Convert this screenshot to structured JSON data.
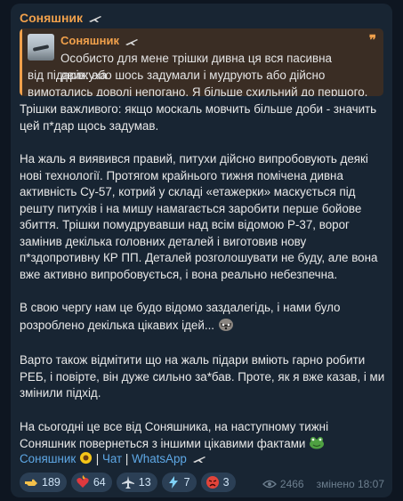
{
  "message": {
    "channel_name": "Соняшник",
    "reply": {
      "author": "Соняшник",
      "line1": "Особисто для мене трішки дивна ця вся пасивна движуха",
      "line2": "від підарів: або шось задумали і мудрують або дійсно",
      "line3": "вимотались доволі непогано. Я більше схильний до першого."
    },
    "paragraphs": [
      "Трішки важливого: якщо москаль мовчить більше доби - значить цей п*дар щось задумав.",
      "На жаль я виявився правий, питухи дійсно випробовують деякі нові технології. Протягом крайнього тижня помічена дивна активність Су-57, котрий у складі «етажерки» маскується під решту питухів і на мишу намагається заробити перше бойове збиття. Трішки помудрувавши над всім відомою Р-37, ворог замінив декілька головних деталей і виготовив нову п*здопротивну КР ПП. Деталей розголошувати не буду, але вона вже активно випробовується, і вона реально небезпечна.",
      "В свою чергу нам це будо відомо заздалегідь, і нами було розроблено декілька цікавих ідей...",
      "Варто також відмітити що на жаль підари вміють гарно робити РЕБ, і повірте, він дуже сильно за*бав. Проте, як я вже казав, і ми змінили підхід.",
      "На сьогодні це все від Соняшника, на наступному тижні Соняшник повернеться з іншими цікавими фактами"
    ],
    "links": {
      "channel": "Соняшник",
      "chat": "Чат",
      "whatsapp": "WhatsApp",
      "separator": "|"
    },
    "reactions": [
      {
        "icon": "hand-pointing-icon",
        "count": "189"
      },
      {
        "icon": "heart-on-fire-icon",
        "count": "64"
      },
      {
        "icon": "plane-icon",
        "count": "13"
      },
      {
        "icon": "lightning-icon",
        "count": "7"
      },
      {
        "icon": "angry-face-icon",
        "count": "3"
      }
    ],
    "views": "2466",
    "edited_time": "змінено 18:07"
  },
  "colors": {
    "background": "#0e1621",
    "bubble": "#182533",
    "accent": "#f0a04b",
    "link": "#5ea8e6",
    "reaction_bg": "#2b3f55"
  }
}
